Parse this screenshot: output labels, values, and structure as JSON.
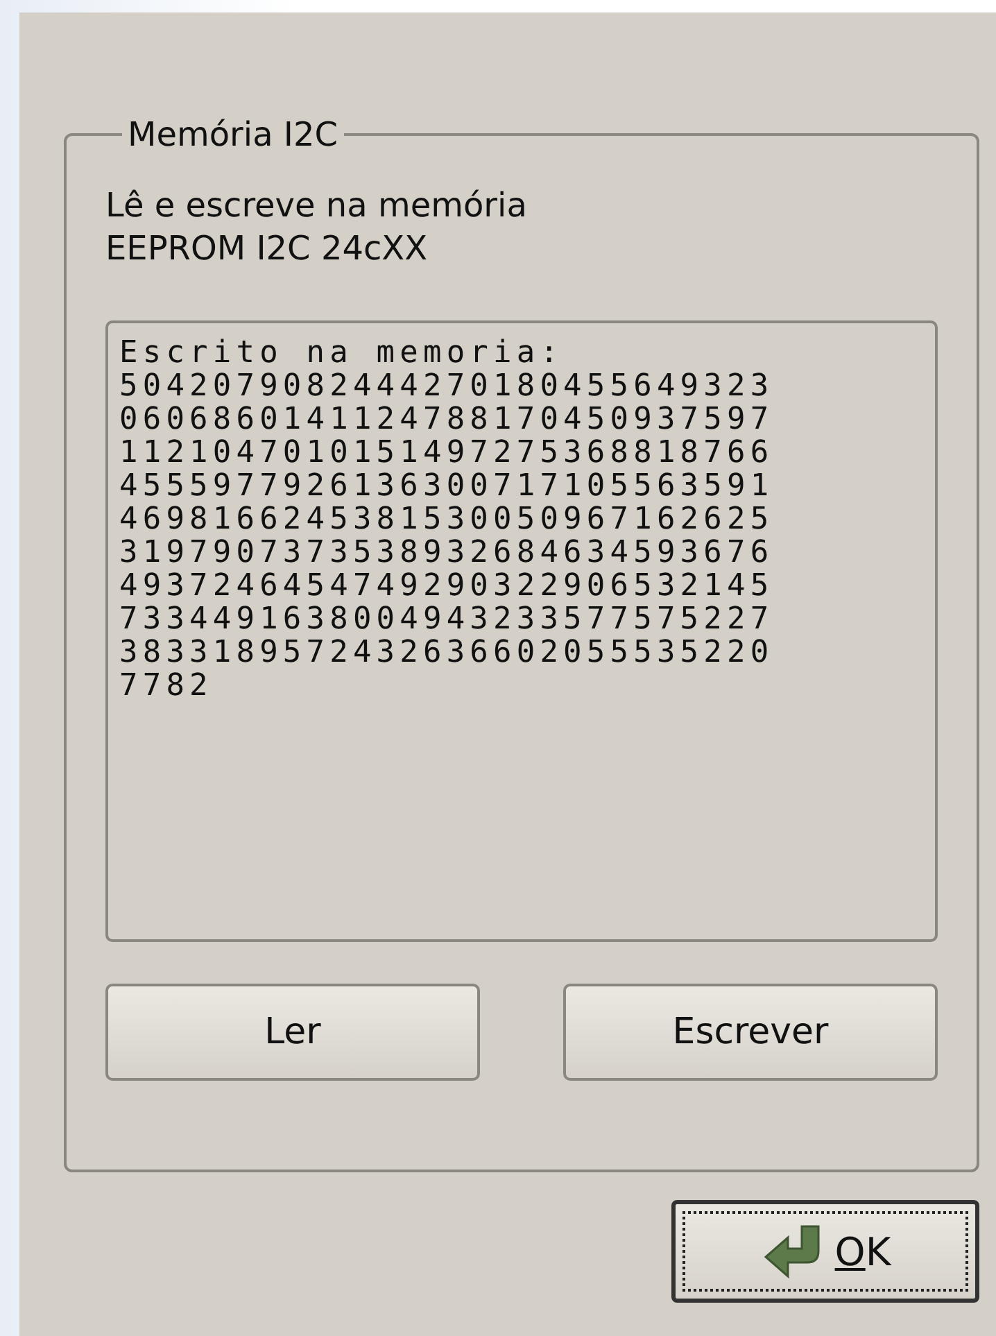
{
  "group": {
    "title": "Memória I2C"
  },
  "description": "Lê e escreve na memória EEPROM I2C 24cXX",
  "memory_text": {
    "lines": [
      "Escrito na memoria:",
      "5042079082444270180455649323",
      "0606860141124788170450937597",
      "1121047010151497275368818766",
      "4555977926136300717105563591",
      "4698166245381530050967162625",
      "3197907373538932684634593676",
      "4937246454749290322906532145",
      "7334491638004943233577575227",
      "3833189572432636602055535220",
      "7782"
    ]
  },
  "buttons": [
    {
      "label": "Ler"
    },
    {
      "label": "Escrever"
    }
  ],
  "ok_button": {
    "label": "OK"
  }
}
